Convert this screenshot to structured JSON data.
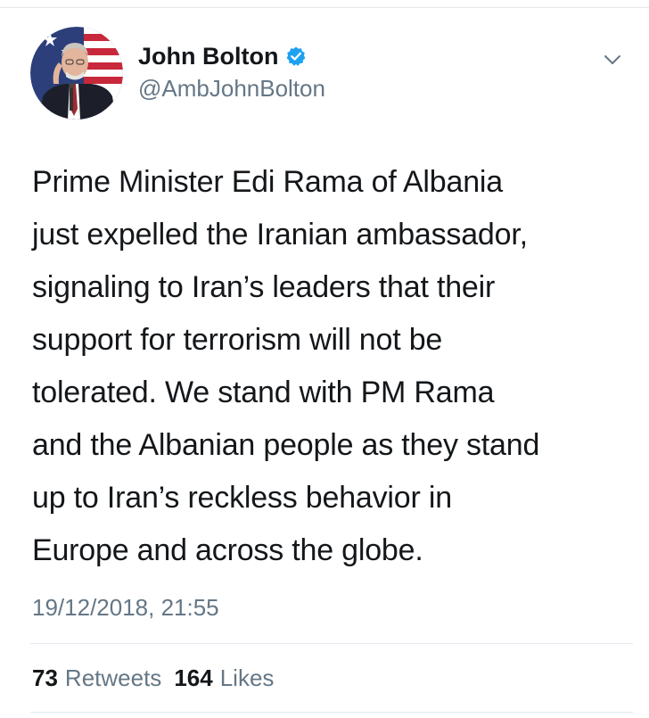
{
  "tweet": {
    "author": {
      "display_name": "John Bolton",
      "handle": "@AmbJohnBolton",
      "verified": true,
      "avatar_icon": "profile-photo"
    },
    "menu_icon": "chevron-down-icon",
    "text": "Prime Minister Edi Rama of Albania\njust expelled the Iranian ambassador,\nsignaling to Iran’s leaders that their\nsupport for terrorism will not be\ntolerated. We stand with PM Rama\nand the Albanian people as they stand\nup to Iran’s reckless behavior in\nEurope and across the globe.",
    "timestamp": "19/12/2018, 21:55",
    "stats": {
      "retweets_count": "73",
      "retweets_label": "Retweets",
      "likes_count": "164",
      "likes_label": "Likes"
    }
  },
  "colors": {
    "text_primary": "#14171a",
    "text_secondary": "#657786",
    "verified_blue": "#1da1f2",
    "divider": "#e1e8ed"
  }
}
